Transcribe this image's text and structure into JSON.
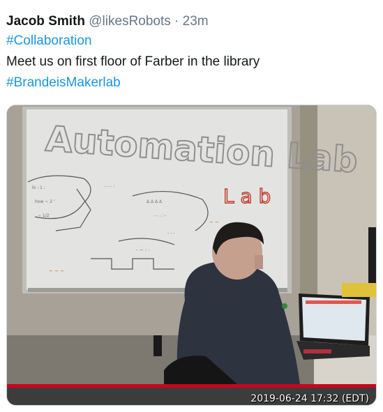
{
  "tweet": {
    "author_name": "Jacob Smith",
    "handle": "@likesRobots",
    "separator": "·",
    "time_ago": "23m",
    "hashtag_1": "#Collaboration",
    "body_text": "Meet us on first floor of Farber in the library",
    "hashtag_2": "#BrandeisMakerlab"
  },
  "media": {
    "whiteboard_text": "Automation Lab",
    "timestamp": "2019-06-24 17:32 (EDT)"
  },
  "colors": {
    "link": "#1b95e0",
    "muted": "#657786",
    "recording_bar": "#d0021b"
  }
}
